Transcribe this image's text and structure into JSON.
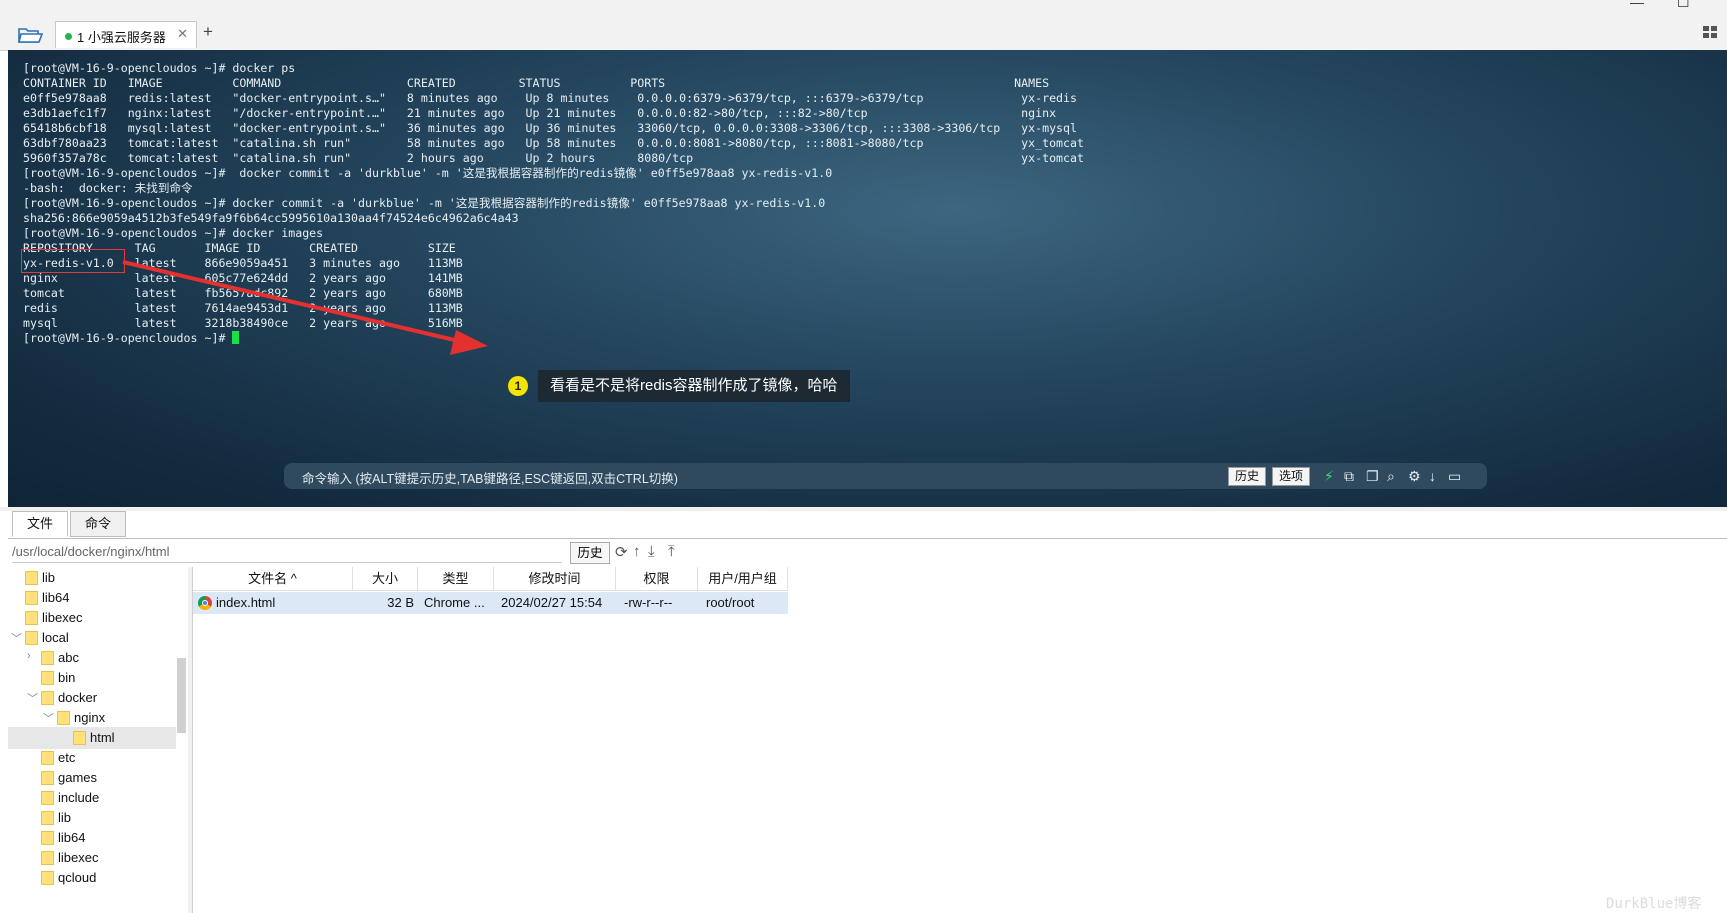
{
  "tab": {
    "label": "1 小强云服务器"
  },
  "terminal": {
    "lines": [
      "[root@VM-16-9-opencloudos ~]# docker ps",
      "CONTAINER ID   IMAGE          COMMAND                  CREATED         STATUS          PORTS                                                  NAMES",
      "e0ff5e978aa8   redis:latest   \"docker-entrypoint.s…\"   8 minutes ago    Up 8 minutes    0.0.0.0:6379->6379/tcp, :::6379->6379/tcp              yx-redis",
      "e3db1aefc1f7   nginx:latest   \"/docker-entrypoint.…\"   21 minutes ago   Up 21 minutes   0.0.0.0:82->80/tcp, :::82->80/tcp                      nginx",
      "65418b6cbf18   mysql:latest   \"docker-entrypoint.s…\"   36 minutes ago   Up 36 minutes   33060/tcp, 0.0.0.0:3308->3306/tcp, :::3308->3306/tcp   yx-mysql",
      "63dbf780aa23   tomcat:latest  \"catalina.sh run\"        58 minutes ago   Up 58 minutes   0.0.0.0:8081->8080/tcp, :::8081->8080/tcp              yx_tomcat",
      "5960f357a78c   tomcat:latest  \"catalina.sh run\"        2 hours ago      Up 2 hours      8080/tcp                                               yx-tomcat",
      "[root@VM-16-9-opencloudos ~]#  docker commit -a 'durkblue' -m '这是我根据容器制作的redis镜像' e0ff5e978aa8 yx-redis-v1.0",
      "-bash:  docker: 未找到命令",
      "[root@VM-16-9-opencloudos ~]# docker commit -a 'durkblue' -m '这是我根据容器制作的redis镜像' e0ff5e978aa8 yx-redis-v1.0",
      "sha256:866e9059a4512b3fe549fa9f6b64cc5995610a130aa4f74524e6c4962a6c4a43",
      "[root@VM-16-9-opencloudos ~]# docker images",
      "REPOSITORY      TAG       IMAGE ID       CREATED          SIZE",
      "yx-redis-v1.0   latest    866e9059a451   3 minutes ago    113MB",
      "nginx           latest    605c77e624dd   2 years ago      141MB",
      "tomcat          latest    fb5657adc892   2 years ago      680MB",
      "redis           latest    7614ae9453d1   2 years ago      113MB",
      "mysql           latest    3218b38490ce   2 years ago      516MB"
    ],
    "prompt": "[root@VM-16-9-opencloudos ~]# "
  },
  "annotation": {
    "number": "1",
    "text": "看看是不是将redis容器制作成了镜像，哈哈"
  },
  "command_bar": {
    "hint": "命令输入 (按ALT键提示历史,TAB键路径,ESC键返回,双击CTRL切换)",
    "history_btn": "历史",
    "options_btn": "选项"
  },
  "file_tabs": [
    "文件",
    "命令"
  ],
  "path_bar": {
    "path": "/usr/local/docker/nginx/html",
    "history_btn": "历史"
  },
  "tree": [
    {
      "name": "lib",
      "indent": 1,
      "chevron": ""
    },
    {
      "name": "lib64",
      "indent": 1,
      "chevron": ""
    },
    {
      "name": "libexec",
      "indent": 1,
      "chevron": ""
    },
    {
      "name": "local",
      "indent": 1,
      "chevron": "down"
    },
    {
      "name": "abc",
      "indent": 2,
      "chevron": "right"
    },
    {
      "name": "bin",
      "indent": 2,
      "chevron": ""
    },
    {
      "name": "docker",
      "indent": 2,
      "chevron": "down"
    },
    {
      "name": "nginx",
      "indent": 3,
      "chevron": "down"
    },
    {
      "name": "html",
      "indent": 4,
      "chevron": "",
      "selected": true
    },
    {
      "name": "etc",
      "indent": 2,
      "chevron": ""
    },
    {
      "name": "games",
      "indent": 2,
      "chevron": ""
    },
    {
      "name": "include",
      "indent": 2,
      "chevron": ""
    },
    {
      "name": "lib",
      "indent": 2,
      "chevron": ""
    },
    {
      "name": "lib64",
      "indent": 2,
      "chevron": ""
    },
    {
      "name": "libexec",
      "indent": 2,
      "chevron": ""
    },
    {
      "name": "qcloud",
      "indent": 2,
      "chevron": ""
    }
  ],
  "file_table": {
    "headers": [
      "文件名 ^",
      "大小",
      "类型",
      "修改时间",
      "权限",
      "用户/用户组"
    ],
    "rows": [
      {
        "name": "index.html",
        "size": "32 B",
        "type": "Chrome ...",
        "mtime": "2024/02/27 15:54",
        "perm": "-rw-r--r--",
        "owner": "root/root"
      }
    ]
  },
  "watermark": "DurkBlue博客",
  "colors": {
    "terminal_bg": "#24465e",
    "cursor": "#19e04a",
    "callout_badge": "#f5e400",
    "highlight": "#e03a3a",
    "selected_row": "#dce8f5"
  }
}
